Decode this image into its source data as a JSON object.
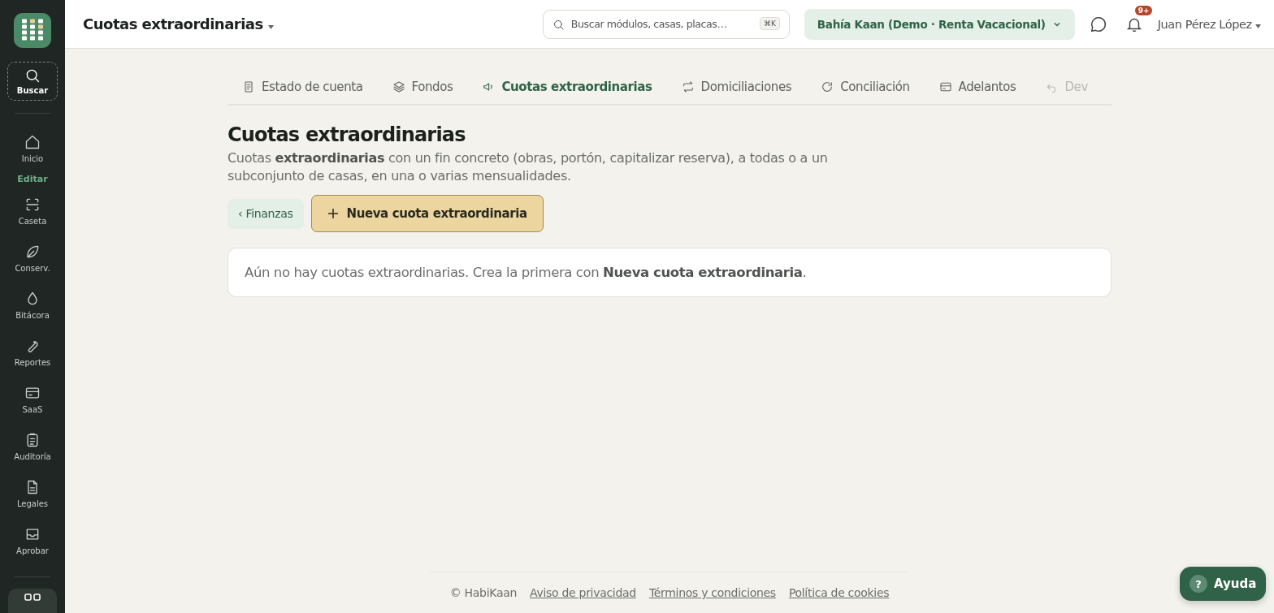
{
  "sidebar": {
    "items": [
      {
        "kind": "search",
        "label": "Buscar",
        "selected": true
      },
      {
        "kind": "link",
        "label": "Inicio",
        "selected": false
      },
      {
        "kind": "section",
        "label": "Editar"
      },
      {
        "kind": "link",
        "label": "Caseta",
        "selected": false
      },
      {
        "kind": "link",
        "label": "Conserv.",
        "selected": false
      },
      {
        "kind": "link",
        "label": "Bitácora",
        "selected": false
      },
      {
        "kind": "link",
        "label": "Reportes",
        "selected": false
      },
      {
        "kind": "link",
        "label": "SaaS",
        "selected": false
      },
      {
        "kind": "link",
        "label": "Auditoría",
        "selected": false
      },
      {
        "kind": "link",
        "label": "Legales",
        "selected": false
      },
      {
        "kind": "link",
        "label": "Aprobar",
        "selected": false
      }
    ]
  },
  "topbar": {
    "title": "Cuotas extraordinarias",
    "search": {
      "placeholder": "Buscar módulos, casas, placas…",
      "shortcut": "⌘K"
    },
    "community": "Bahía Kaan (Demo · Renta Vacacional)",
    "notifications": "9+",
    "user": "Juan Pérez López"
  },
  "tabs": [
    {
      "label": "Estado de cuenta",
      "selected": false
    },
    {
      "label": "Fondos",
      "selected": false
    },
    {
      "label": "Cuotas extraordinarias",
      "selected": true
    },
    {
      "label": "Domiciliaciones",
      "selected": false
    },
    {
      "label": "Conciliación",
      "selected": false
    },
    {
      "label": "Adelantos",
      "selected": false
    },
    {
      "label": "Dev",
      "selected": false
    }
  ],
  "page": {
    "title": "Cuotas extraordinarias",
    "description": "Cuotas **extraordinarias** con un fin concreto (obras, portón, capitalizar reserva), a todas o a un subconjunto de casas, en una o varias mensualidades.",
    "back_button": "‹ Finanzas",
    "new_button": "Nueva cuota extraordinaria",
    "empty_message": "Aún no hay cuotas extraordinarias. Crea la primera con **Nueva cuota extraordinaria**."
  },
  "footer": {
    "copyright": "© HabiKaan",
    "links": [
      "Aviso de privacidad",
      "Términos y condiciones",
      "Política de cookies"
    ]
  },
  "help_button": {
    "icon": "?",
    "label": "Ayuda"
  }
}
